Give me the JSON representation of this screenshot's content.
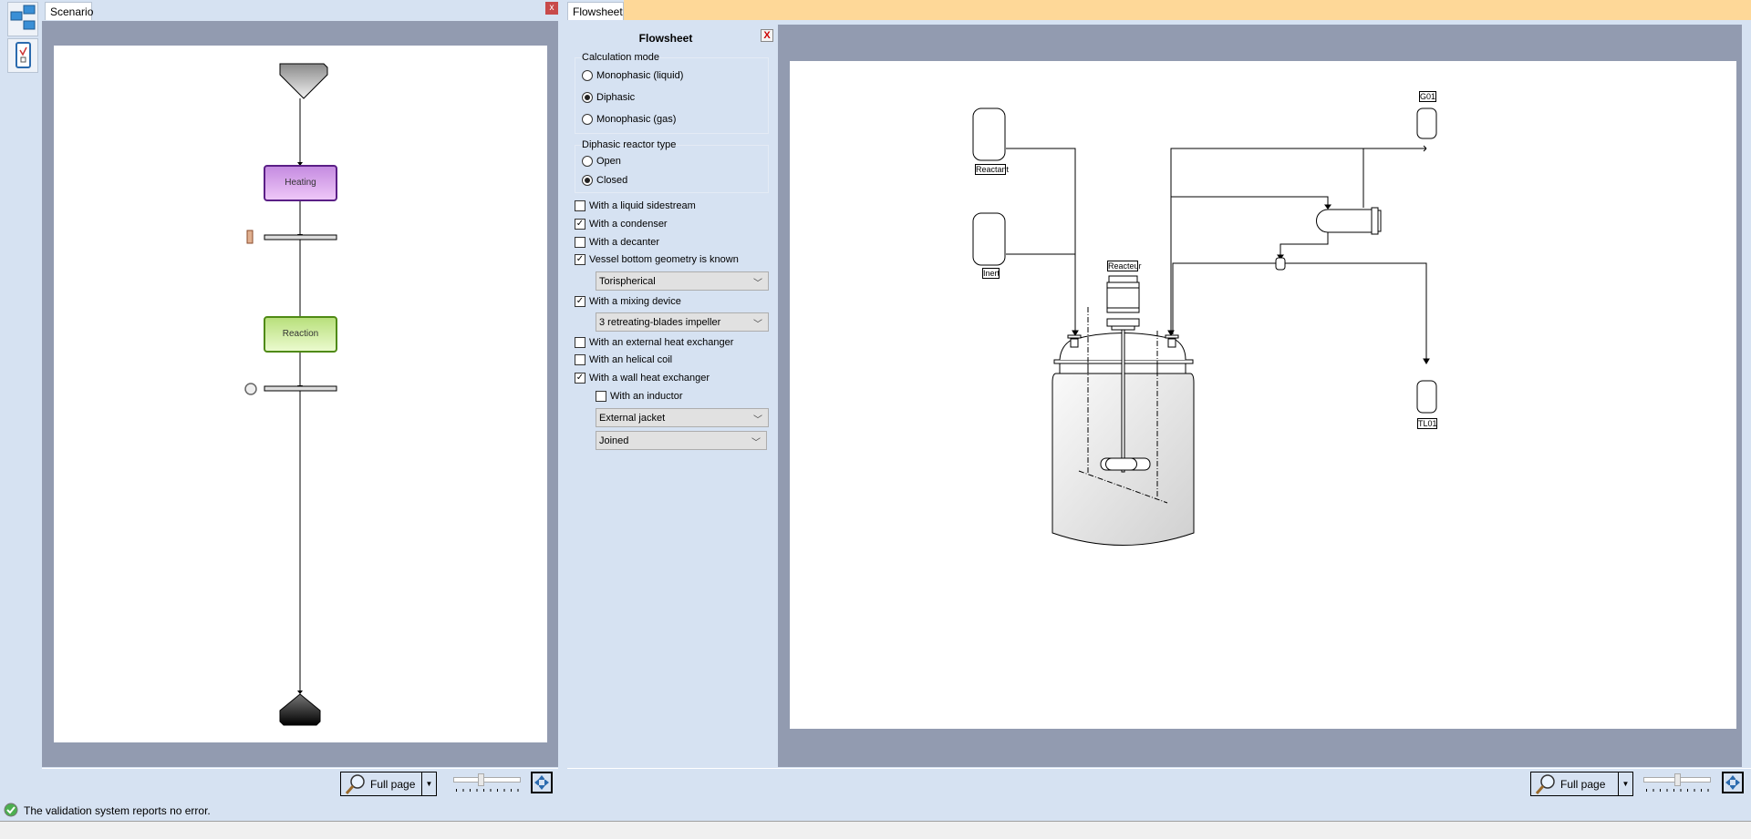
{
  "sidebar": {
    "icons": [
      "flowsheet-blocks-icon",
      "clipboard-check-icon"
    ]
  },
  "scenario": {
    "tab": "Scenario",
    "close": "x",
    "nodes": {
      "heating": "Heating",
      "reaction": "Reaction"
    },
    "zoom": {
      "label": "Full page",
      "slider_level": 0.4
    }
  },
  "flowsheet": {
    "tab": "Flowsheet",
    "zoom": {
      "label": "Full page",
      "slider_level": 0.5
    },
    "options": {
      "title": "Flowsheet",
      "close": "X",
      "calc_mode": {
        "label": "Calculation mode",
        "options": [
          "Monophasic (liquid)",
          "Diphasic",
          "Monophasic (gas)"
        ],
        "selected": "Diphasic"
      },
      "reactor_type": {
        "label": "Diphasic reactor type",
        "options": [
          "Open",
          "Closed"
        ],
        "selected": "Closed"
      },
      "checks": [
        {
          "label": "With a liquid sidestream",
          "checked": false
        },
        {
          "label": "With a condenser",
          "checked": true
        },
        {
          "label": "With a decanter",
          "checked": false
        },
        {
          "label": "Vessel bottom geometry is known",
          "checked": true
        },
        {
          "label": "With a mixing device",
          "checked": true
        },
        {
          "label": "With an external heat exchanger",
          "checked": false
        },
        {
          "label": "With an helical coil",
          "checked": false
        },
        {
          "label": "With a wall heat exchanger",
          "checked": true
        },
        {
          "label": "With an inductor",
          "checked": false
        }
      ],
      "selects": {
        "bottom": "Torispherical",
        "mixer": "3 retreating-blades impeller",
        "wall_hx": "External jacket",
        "joint": "Joined"
      }
    },
    "diagram": {
      "reactant": "Reactant",
      "inert": "Inert",
      "reactor": "Reacteur",
      "gas_out": "G01",
      "liquid_out": "TL01"
    }
  },
  "status": {
    "message": "The validation system reports no error."
  },
  "colors": {
    "heating": "#c98ae6",
    "reaction": "#b9e27f",
    "tab_accent": "#fed898",
    "status_ok": "#4caf50"
  }
}
